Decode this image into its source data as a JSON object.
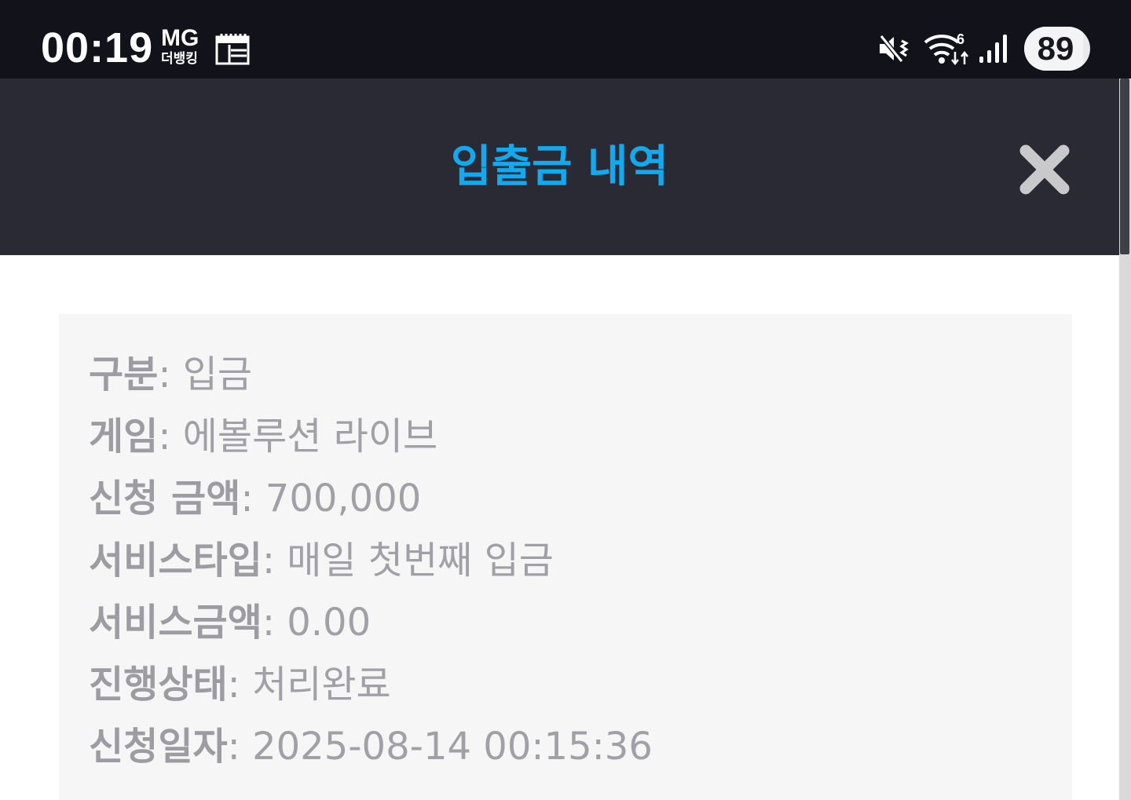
{
  "status_bar": {
    "time": "00:19",
    "carrier_top": "MG",
    "carrier_bottom": "더뱅킹",
    "battery_level": "89",
    "battery_percent": 89,
    "icons": [
      "calendar-icon",
      "mute-icon",
      "wifi-icon",
      "signal-icon"
    ]
  },
  "header": {
    "title": "입출금 내역",
    "title_color": "#12a9ee",
    "background_color": "#2a2a35",
    "close_icon": "close-icon"
  },
  "details": {
    "separator": ": ",
    "rows": [
      {
        "label": "구분",
        "value": "입금"
      },
      {
        "label": "게임",
        "value": "에볼루션 라이브"
      },
      {
        "label": "신청 금액",
        "value": "700,000"
      },
      {
        "label": "서비스타입",
        "value": "매일 첫번째 입금"
      },
      {
        "label": "서비스금액",
        "value": "0.00"
      },
      {
        "label": "진행상태",
        "value": "처리완료"
      },
      {
        "label": "신청일자",
        "value": "2025-08-14 00:15:36"
      }
    ]
  }
}
